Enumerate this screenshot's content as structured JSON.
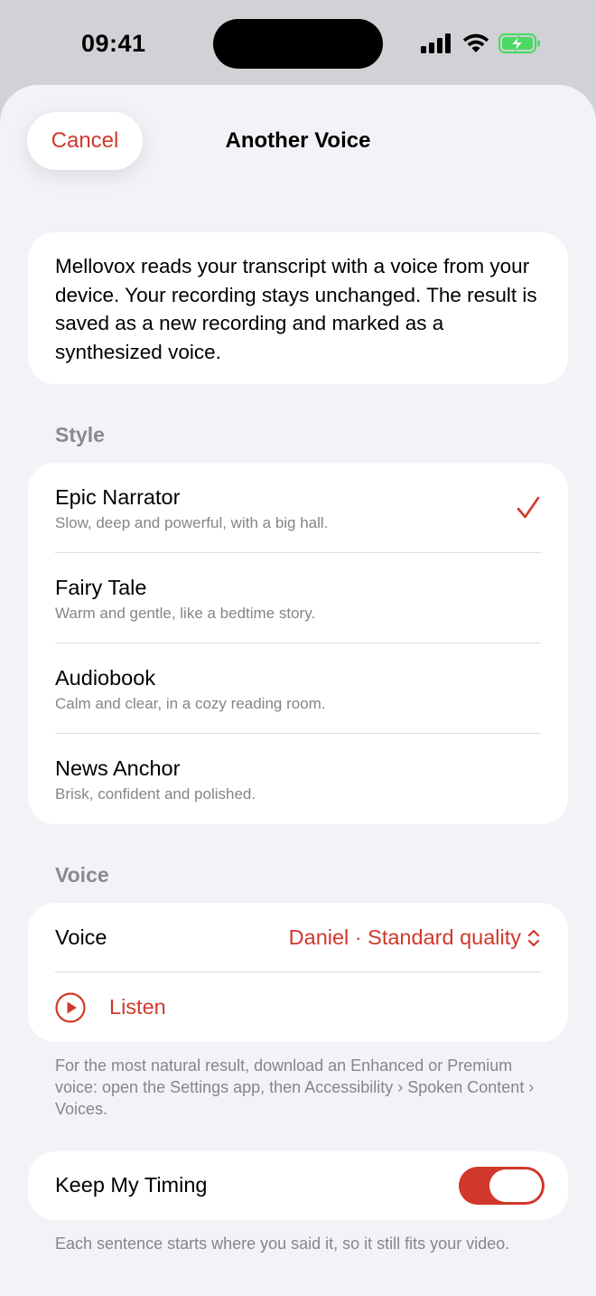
{
  "status_bar": {
    "time": "09:41",
    "icons": [
      "cellular-signal-icon",
      "wifi-icon",
      "battery-charging-icon"
    ]
  },
  "nav": {
    "cancel_label": "Cancel",
    "title": "Another Voice"
  },
  "intro_text": "Mellovox reads your transcript with a voice from your device. Your recording stays unchanged. The result is saved as a new recording and marked as a synthesized voice.",
  "style_section": {
    "label": "Style",
    "items": [
      {
        "name": "Epic Narrator",
        "description": "Slow, deep and powerful, with a big hall.",
        "selected": true
      },
      {
        "name": "Fairy Tale",
        "description": "Warm and gentle, like a bedtime story.",
        "selected": false
      },
      {
        "name": "Audiobook",
        "description": "Calm and clear, in a cozy reading room.",
        "selected": false
      },
      {
        "name": "News Anchor",
        "description": "Brisk, confident and polished.",
        "selected": false
      }
    ]
  },
  "voice_section": {
    "label": "Voice",
    "voice_label": "Voice",
    "voice_value": "Daniel · Standard quality",
    "listen_label": "Listen",
    "footnote": "For the most natural result, download an Enhanced or Premium voice: open the Settings app, then Accessibility › Spoken Content › Voices."
  },
  "timing": {
    "label": "Keep My Timing",
    "enabled": true,
    "footnote": "Each sentence starts where you said it, so it still fits your video."
  },
  "colors": {
    "accent": "#d0382b",
    "background": "#f2f2f7",
    "secondary_text": "#85858a",
    "section_label": "#8a8a8e",
    "battery": "#4cd964"
  }
}
